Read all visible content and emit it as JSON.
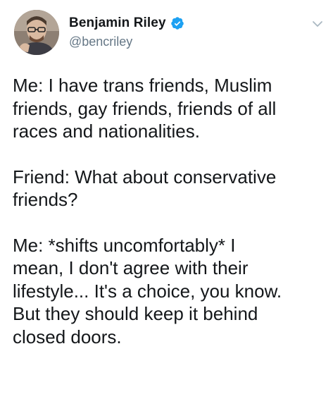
{
  "author": {
    "display_name": "Benjamin Riley",
    "handle": "@bencriley",
    "verified": true
  },
  "icons": {
    "verified": "verified-badge-icon",
    "menu": "chevron-down-icon"
  },
  "colors": {
    "verified_blue": "#1da1f2",
    "handle_gray": "#657786",
    "text": "#14171a"
  },
  "tweet": {
    "paragraphs": [
      {
        "lines": [
          "Me: I have trans friends, Muslim",
          "friends, gay friends, friends of all",
          "races and nationalities."
        ]
      },
      {
        "lines": [
          "Friend: What about conservative",
          "friends?"
        ]
      },
      {
        "lines": [
          "Me: *shifts uncomfortably* I",
          "mean, I don't agree with their",
          "lifestyle... It's a choice, you know.",
          "But they should keep it behind",
          "closed doors."
        ]
      }
    ]
  }
}
